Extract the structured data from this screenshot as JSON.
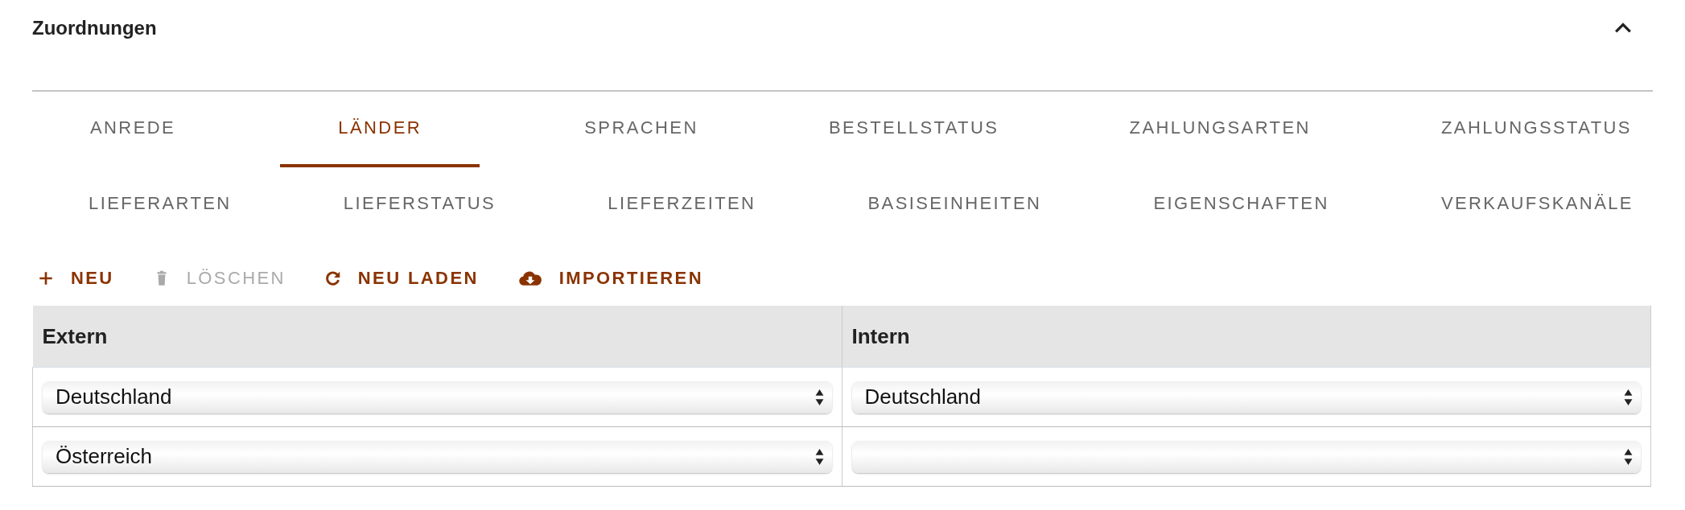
{
  "panel": {
    "title": "Zuordnungen",
    "expanded": true
  },
  "tab_rows": [
    [
      {
        "label": "ANREDE",
        "selected": false
      },
      {
        "label": "LÄNDER",
        "selected": true
      },
      {
        "label": "SPRACHEN",
        "selected": false
      },
      {
        "label": "BESTELLSTATUS",
        "selected": false
      },
      {
        "label": "ZAHLUNGSARTEN",
        "selected": false
      },
      {
        "label": "ZAHLUNGSSTATUS",
        "selected": false
      }
    ],
    [
      {
        "label": "LIEFERARTEN",
        "selected": false
      },
      {
        "label": "LIEFERSTATUS",
        "selected": false
      },
      {
        "label": "LIEFERZEITEN",
        "selected": false
      },
      {
        "label": "BASISEINHEITEN",
        "selected": false
      },
      {
        "label": "EIGENSCHAFTEN",
        "selected": false
      },
      {
        "label": "VERKAUFSKANÄLE",
        "selected": false
      }
    ]
  ],
  "toolbar": [
    {
      "kind": "add",
      "label": "NEU",
      "disabled": false
    },
    {
      "kind": "delete",
      "label": "LÖSCHEN",
      "disabled": true
    },
    {
      "kind": "reload",
      "label": "NEU LADEN",
      "disabled": false
    },
    {
      "kind": "import",
      "label": "IMPORTIEREN",
      "disabled": false
    }
  ],
  "table": {
    "columns": [
      "Extern",
      "Intern"
    ],
    "rows": [
      {
        "extern": "Deutschland",
        "intern": "Deutschland"
      },
      {
        "extern": "Österreich"
      }
    ]
  }
}
